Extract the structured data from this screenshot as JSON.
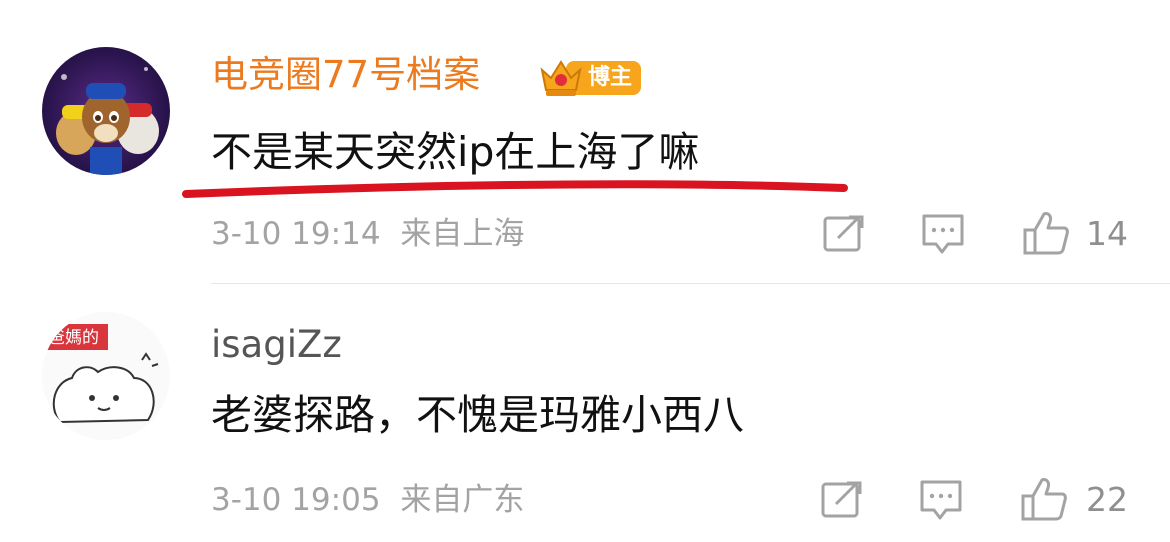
{
  "comments": [
    {
      "username": "电竞圈77号档案",
      "badge": "博主",
      "text": "不是某天突然ip在上海了嘛",
      "timestamp": "3-10 19:14",
      "location": "来自上海",
      "likes": "14"
    },
    {
      "username": "isagiZz",
      "avatar_text": "爸媽的",
      "text": "老婆探路，不愧是玛雅小西八",
      "timestamp": "3-10 19:05",
      "location": "来自广东",
      "likes": "22"
    }
  ],
  "colors": {
    "username_orange": "#ec7a1e",
    "underline_red": "#d9131f",
    "meta_gray": "#a3a3a3",
    "badge_orange": "#f7a51c"
  }
}
